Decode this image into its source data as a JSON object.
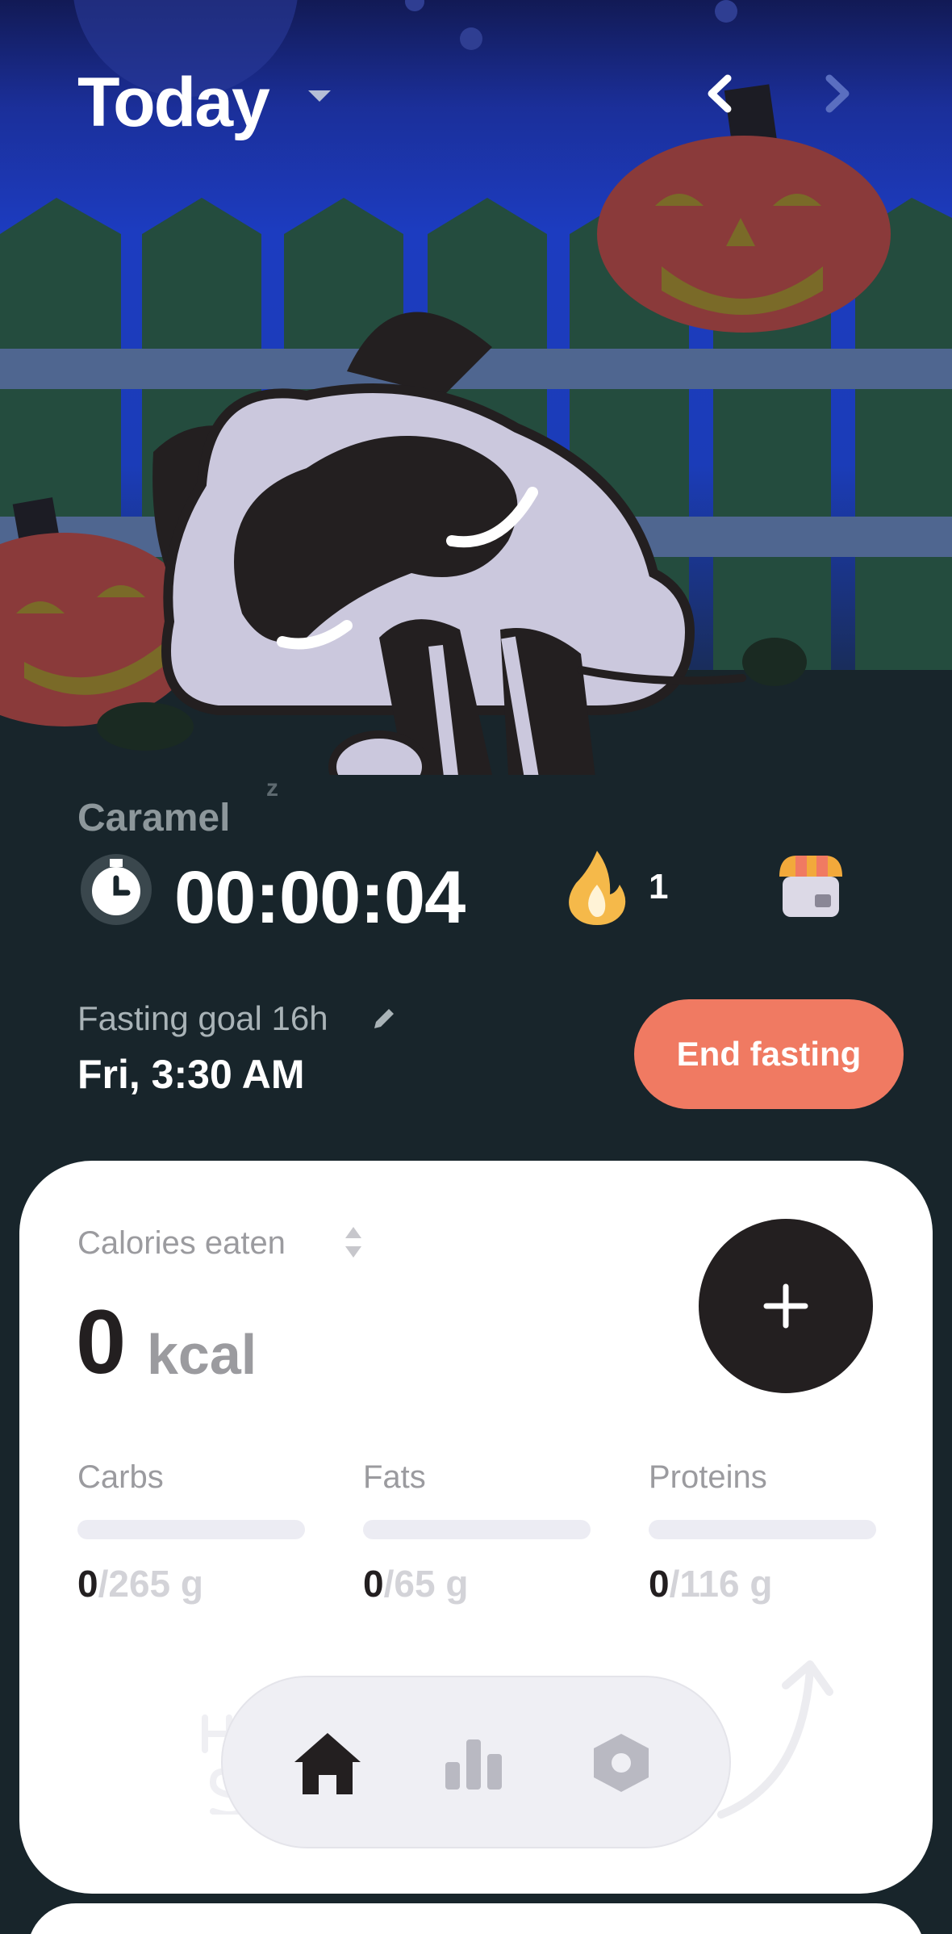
{
  "header": {
    "title": "Today"
  },
  "pet": {
    "name": "Caramel",
    "sleep_mark": "z"
  },
  "timer": {
    "elapsed": "00:00:04"
  },
  "streak": {
    "count": "1"
  },
  "fasting": {
    "goal_label": "Fasting goal 16h",
    "end_time": "Fri, 3:30 AM",
    "end_button": "End fasting"
  },
  "calories": {
    "label": "Calories eaten",
    "value": "0",
    "unit": "kcal"
  },
  "macros": [
    {
      "name": "Carbs",
      "eaten": "0",
      "sep": "/",
      "goal": "265 g",
      "progress": 0
    },
    {
      "name": "Fats",
      "eaten": "0",
      "sep": "/",
      "goal": "65 g",
      "progress": 0
    },
    {
      "name": "Proteins",
      "eaten": "0",
      "sep": "/",
      "goal": "116 g",
      "progress": 0
    }
  ],
  "colors": {
    "accent": "#f07a62",
    "dark": "#231f20",
    "background": "#18252b",
    "card": "#ffffff"
  },
  "icons": {
    "back": "chevron-left-icon",
    "forward": "chevron-right-icon",
    "timer": "stopwatch-icon",
    "streak": "flame-icon",
    "shop": "shop-icon",
    "edit": "pencil-icon",
    "sort": "sort-icon",
    "add": "plus-icon",
    "home": "home-icon",
    "stats": "bar-chart-icon",
    "settings": "hexagon-icon"
  },
  "nav": {
    "active": "home"
  }
}
